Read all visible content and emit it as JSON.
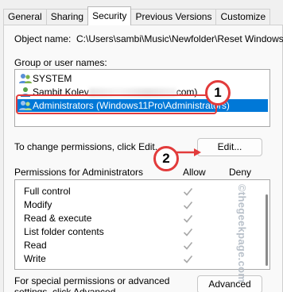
{
  "tabs": [
    "General",
    "Sharing",
    "Security",
    "Previous Versions",
    "Customize"
  ],
  "active_tab": "Security",
  "object_name": {
    "label": "Object name:",
    "value": "C:\\Users\\sambi\\Music\\Newfolder\\Reset Windows"
  },
  "groups": {
    "label": "Group or user names:",
    "users": [
      {
        "name": "SYSTEM"
      },
      {
        "name_start": "Sambit Kolev",
        "name_end": "com)"
      },
      {
        "name": "Administrators (Windows11Pro\\Administrators)"
      }
    ]
  },
  "change_permissions": {
    "text": "To change permissions, click Edit.",
    "edit_label": "Edit..."
  },
  "permissions": {
    "label": "Permissions for Administrators",
    "allow_header": "Allow",
    "deny_header": "Deny",
    "rows": [
      {
        "name": "Full control",
        "allow": true,
        "deny": false
      },
      {
        "name": "Modify",
        "allow": true,
        "deny": false
      },
      {
        "name": "Read & execute",
        "allow": true,
        "deny": false
      },
      {
        "name": "List folder contents",
        "allow": true,
        "deny": false
      },
      {
        "name": "Read",
        "allow": true,
        "deny": false
      },
      {
        "name": "Write",
        "allow": true,
        "deny": false
      }
    ]
  },
  "special": {
    "text": "For special permissions or advanced settings, click Advanced.",
    "advanced_label": "Advanced"
  },
  "callouts": [
    "1",
    "2"
  ],
  "watermark": "©thegeekpage.com",
  "colors": {
    "selection": "#0078d7",
    "callout": "#e23b3b",
    "check": "#a8a8a8"
  }
}
